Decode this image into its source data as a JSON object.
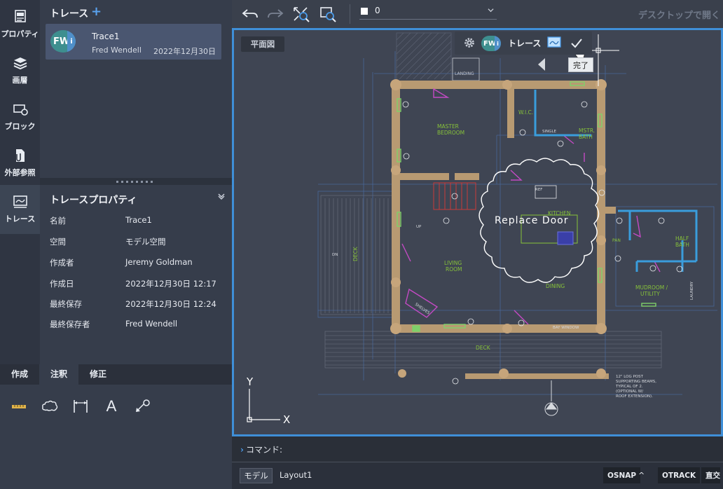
{
  "rail": [
    {
      "id": "properties",
      "label": "プロパティ",
      "icon": "properties-icon"
    },
    {
      "id": "layers",
      "label": "画層",
      "icon": "layers-icon"
    },
    {
      "id": "blocks",
      "label": "ブロック",
      "icon": "block-icon"
    },
    {
      "id": "xref",
      "label": "外部参照",
      "icon": "xref-icon"
    },
    {
      "id": "trace",
      "label": "トレース",
      "icon": "trace-icon",
      "active": true
    }
  ],
  "traces_panel": {
    "title": "トレース",
    "add_label": "+",
    "items": [
      {
        "initials": "FW",
        "badge": "i",
        "name": "Trace1",
        "user": "Fred Wendell",
        "date": "2022年12月30日"
      }
    ]
  },
  "trace_properties": {
    "title": "トレースプロパティ",
    "rows": [
      {
        "key": "名前",
        "value": "Trace1"
      },
      {
        "key": "空間",
        "value": "モデル空間"
      },
      {
        "key": "作成者",
        "value": "Jeremy Goldman"
      },
      {
        "key": "作成日",
        "value": "2022年12月30日 12:17"
      },
      {
        "key": "最終保存",
        "value": "2022年12月30日 12:24"
      },
      {
        "key": "最終保存者",
        "value": "Fred Wendell"
      }
    ]
  },
  "tool_tabs": {
    "tabs": [
      {
        "label": "作成"
      },
      {
        "label": "注釈",
        "active": true
      },
      {
        "label": "修正"
      }
    ],
    "tools": [
      "measure-icon",
      "cloud-icon",
      "dimension-icon",
      "text-icon",
      "leader-icon"
    ],
    "text_tool_glyph": "A"
  },
  "toolbar": {
    "layer_name": "0",
    "open_desktop": "デスクトップで開く"
  },
  "canvas": {
    "view_label": "平面図",
    "trace_bar": {
      "initials": "FW",
      "badge": "i",
      "label": "トレース"
    },
    "done_tooltip": "完了",
    "markup_text": "Replace Door",
    "ucs": {
      "y": "Y",
      "x": "X"
    },
    "plan_labels": {
      "landing": "LANDING",
      "master_bedroom": "MASTER\nBEDROOM",
      "wic": "W.I.C.",
      "mstr_bath": "MSTR.\nBATH",
      "single": "SINGLE",
      "kitchen": "KITCHEN",
      "living_room": "LIVING\nROOM",
      "dining": "DINING",
      "deck_left": "DECK",
      "deck_bottom": "DECK",
      "half_bath": "HALF\nBATH",
      "mudroom": "MUDROOM /\nUTILITY",
      "pan": "PAN",
      "laundry": "LAUNDRY",
      "bay_window": "BAY WINDOW",
      "shelves": "SHELVES",
      "ref": "REF",
      "note": "12\" LOG POST\nSUPPORTING BEAMS,\nTYPICAL OF 2.\n(OPTIONAL W/\nROOF EXTENSION).",
      "up": "UP",
      "dn": "DN"
    }
  },
  "command_line": {
    "prompt": "コマンド:"
  },
  "status_bar": {
    "model_tab": "モデル",
    "layout_tab": "Layout1",
    "osnap": "OSNAP",
    "osnap_caret": "^",
    "otrack": "OTRACK",
    "ortho": "直交"
  }
}
